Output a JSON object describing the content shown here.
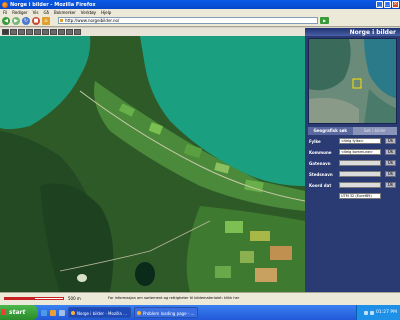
{
  "window": {
    "title": "Norge i bilder - Mozilla Firefox",
    "menus": [
      "Fil",
      "Rediger",
      "Vis",
      "Gå",
      "Bokmerker",
      "Verktøy",
      "Hjelp"
    ],
    "url": "http://www.norgeibilder.no/",
    "go_label": "▶"
  },
  "brand": "Norge i bilder",
  "panel": {
    "tabs": [
      "Geografisk søk",
      "Søk i bilder"
    ],
    "fields": [
      {
        "label": "Fylke",
        "value": "<Velg fylke>",
        "kind": "select"
      },
      {
        "label": "Kommune",
        "value": "<Velg kommune>",
        "kind": "select"
      },
      {
        "label": "Gatenavn",
        "value": "",
        "kind": "input"
      },
      {
        "label": "Stedsnavn",
        "value": "",
        "kind": "input"
      },
      {
        "label": "Koord dat",
        "value": "",
        "kind": "input"
      },
      {
        "label": "",
        "value": "UTM 32 (Euref89)",
        "kind": "select"
      }
    ],
    "button_label": "Ok"
  },
  "status": {
    "scale": "500 m",
    "info": "For informasjon om sortement og rettigheter til bildematerialet: klikk her"
  },
  "taskbar": {
    "start": "start",
    "items": [
      "Norge i bilder - Mozilla ...",
      "Problem loading page - ..."
    ],
    "clock": "01:27 PM"
  },
  "colors": {
    "titlebar": "#0846c8",
    "panel_bg": "#2a3a72",
    "water": "#1aa080",
    "forest": "#2e6a2a",
    "field": "#6ab04a"
  }
}
